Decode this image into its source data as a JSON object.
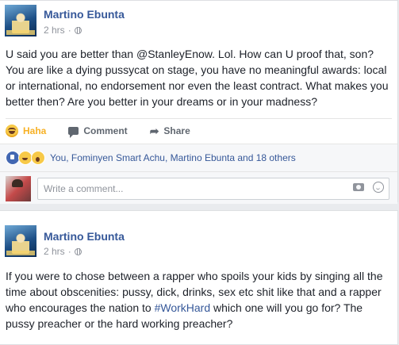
{
  "posts": [
    {
      "author": "Martino Ebunta",
      "time": "2 hrs",
      "text": "U said you are better than @StanleyEnow. Lol. How can U proof that, son? You are like a dying pussycat on stage, you have no meaningful awards: local or international, no endorsement nor even the least contract. What makes you better then? Are you better in your dreams or in your madness?",
      "actions": {
        "reaction_label": "Haha",
        "comment_label": "Comment",
        "share_label": "Share"
      },
      "reactions": {
        "icons": [
          "like-icon",
          "haha-icon",
          "wow-icon"
        ],
        "names": "You, Fominyen Smart Achu, Martino Ebunta and 18 others"
      },
      "comment_box": {
        "placeholder": "Write a comment..."
      }
    },
    {
      "author": "Martino Ebunta",
      "time": "2 hrs",
      "text_before": "If you were to chose between a rapper who spoils your kids by singing all the time about obscenities: pussy, dick, drinks, sex etc shit like that and a rapper who encourages the nation to ",
      "hashtag": "#WorkHard",
      "text_after": " which one will you go for? The pussy preacher or the hard working preacher?"
    }
  ],
  "colors": {
    "link": "#365899",
    "haha": "#f7b125",
    "background": "#e9ebee"
  }
}
